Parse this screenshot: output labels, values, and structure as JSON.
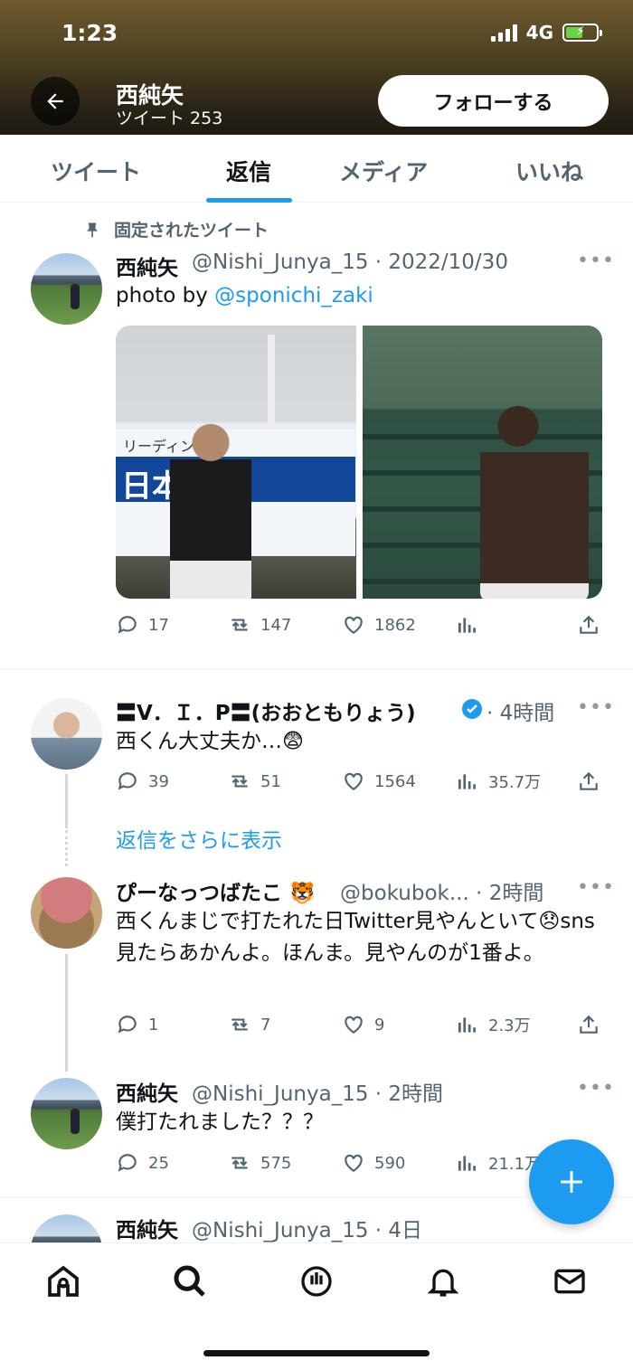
{
  "status_bar": {
    "time": "1:23",
    "network": "4G"
  },
  "header": {
    "name": "西純矢",
    "tweet_count": "ツイート 253",
    "follow_label": "フォローする"
  },
  "tabs": [
    {
      "label": "ツイート"
    },
    {
      "label": "返信"
    },
    {
      "label": "メディア"
    },
    {
      "label": "いいね"
    }
  ],
  "active_tab": "返信",
  "pinned_label": "固定されたツイート",
  "tweets": [
    {
      "name": "西純矢",
      "meta": "@Nishi_Junya_15 · 2022/10/30",
      "text_prefix": "photo by ",
      "text_link": "@sponichi_zaki",
      "media_text_1": "リーディン",
      "media_text_2": "日本",
      "replies": "17",
      "retweets": "147",
      "likes": "1862",
      "views": ""
    },
    {
      "name": "〓V．Ｉ．P〓(おおともりょう)",
      "meta": "· 4時間",
      "text": "西くん大丈夫か…😨",
      "replies": "39",
      "retweets": "51",
      "likes": "1564",
      "views": "35.7万"
    },
    {
      "name": "ぴーなっつばたこ 🐯",
      "meta": "@bokubok... · 2時間",
      "text": "西くんまじで打たれた日Twitter見やんといて😞sns見たらあかんよ。ほんま。見やんのが1番よ。",
      "replies": "1",
      "retweets": "7",
      "likes": "9",
      "views": "2.3万"
    },
    {
      "name": "西純矢",
      "meta": "@Nishi_Junya_15 · 2時間",
      "text": "僕打たれました？？？",
      "replies": "25",
      "retweets": "575",
      "likes": "590",
      "views": "21.1万"
    },
    {
      "name": "西純矢",
      "meta": "@Nishi_Junya_15 · 4日"
    }
  ],
  "show_more_replies": "返信をさらに表示",
  "colors": {
    "accent": "#1d9bf0",
    "text": "#0f1419",
    "muted": "#536471"
  }
}
